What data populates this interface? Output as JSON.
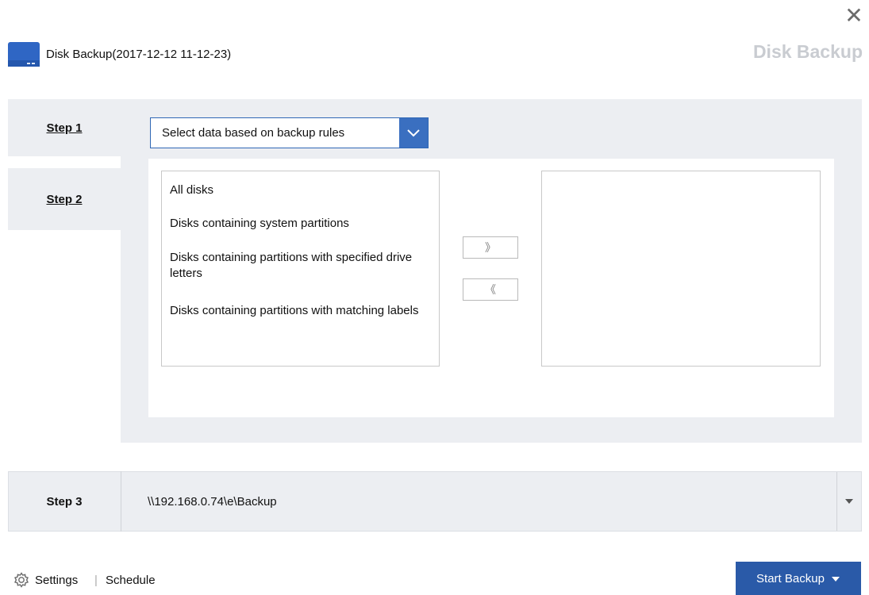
{
  "header": {
    "task_title": "Disk Backup(2017-12-12 11-12-23)",
    "brand_title": "Disk Backup",
    "close_icon": "close-icon",
    "disk_icon": "disk-icon"
  },
  "steps": {
    "step1": "Step 1",
    "step2": "Step 2",
    "step3": "Step 3"
  },
  "step2_panel": {
    "select_value": "Select data based on backup rules",
    "available_rules": [
      "All disks",
      "Disks containing system partitions",
      "Disks containing partitions with specified drive letters",
      "Disks containing partitions with matching labels"
    ],
    "selected_rules": [],
    "add_button": "》",
    "remove_button": "《"
  },
  "step3_panel": {
    "destination_path": "\\\\192.168.0.74\\e\\Backup"
  },
  "footer": {
    "settings_label": "Settings",
    "separator": "|",
    "schedule_label": "Schedule",
    "start_button_label": "Start Backup"
  },
  "colors": {
    "accent": "#2a5aa8",
    "panel": "#eceef2",
    "brand_text": "#c9ccd1"
  }
}
